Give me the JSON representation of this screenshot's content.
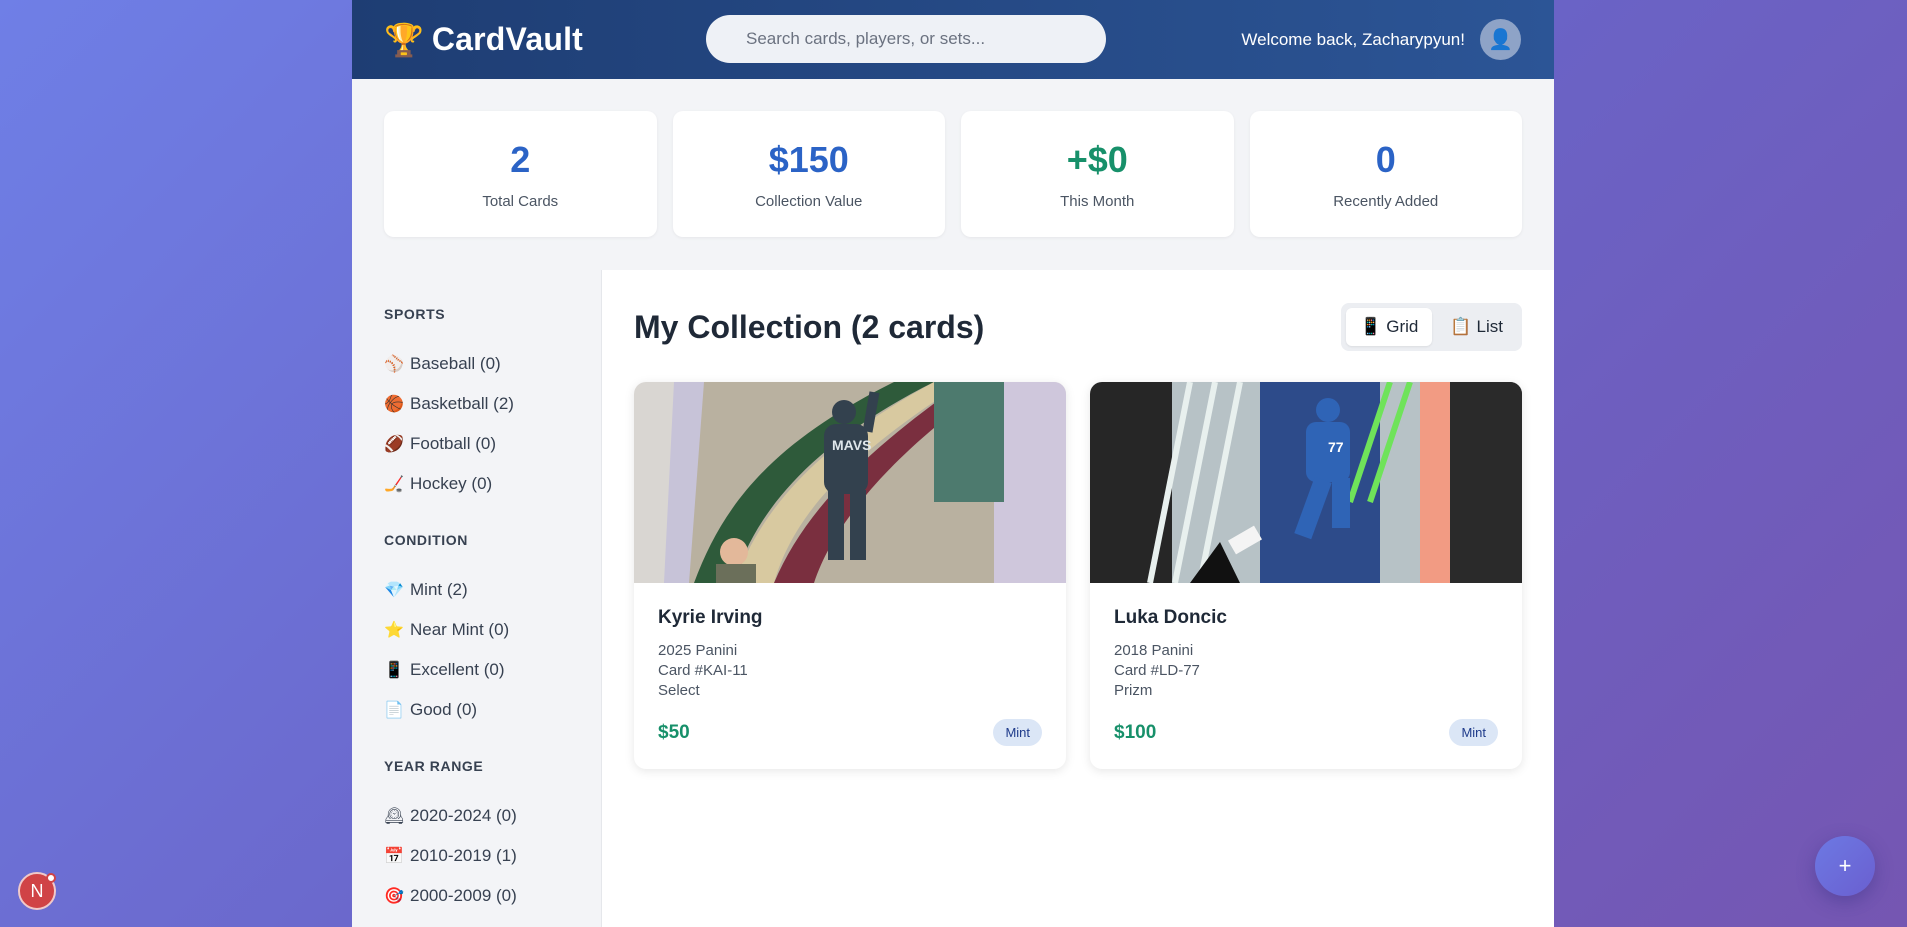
{
  "header": {
    "logo_icon": "trophy-icon",
    "logo_glyph": "🏆",
    "brand": "CardVault",
    "search_placeholder": "Search cards, players, or sets...",
    "welcome": "Welcome back, Zacharypyun!",
    "avatar_glyph": "👤"
  },
  "stats": [
    {
      "value": "2",
      "label": "Total Cards"
    },
    {
      "value": "$150",
      "label": "Collection Value"
    },
    {
      "value": "+$0",
      "label": "This Month"
    },
    {
      "value": "0",
      "label": "Recently Added"
    }
  ],
  "sidebar": {
    "sports": {
      "title": "SPORTS",
      "items": [
        {
          "icon": "⚾",
          "label": "Baseball (0)"
        },
        {
          "icon": "🏀",
          "label": "Basketball (2)"
        },
        {
          "icon": "🏈",
          "label": "Football (0)"
        },
        {
          "icon": "🏒",
          "label": "Hockey (0)"
        }
      ]
    },
    "condition": {
      "title": "CONDITION",
      "items": [
        {
          "icon": "💎",
          "label": "Mint (2)"
        },
        {
          "icon": "⭐",
          "label": "Near Mint (0)"
        },
        {
          "icon": "📱",
          "label": "Excellent (0)"
        },
        {
          "icon": "📄",
          "label": "Good (0)"
        }
      ]
    },
    "years": {
      "title": "YEAR RANGE",
      "items": [
        {
          "icon": "🕰",
          "label": "2020-2024 (0)"
        },
        {
          "icon": "📅",
          "label": "2010-2019 (1)"
        },
        {
          "icon": "🎯",
          "label": "2000-2009 (0)"
        }
      ]
    }
  },
  "main": {
    "title": "My Collection (2 cards)",
    "view_toggle": {
      "grid": {
        "icon": "📱",
        "label": "Grid"
      },
      "list": {
        "icon": "📋",
        "label": "List"
      }
    },
    "cards": [
      {
        "name": "Kyrie Irving",
        "year_brand": "2025 Panini",
        "number": "Card #KAI-11",
        "set": "Select",
        "price": "$50",
        "condition": "Mint"
      },
      {
        "name": "Luka Doncic",
        "year_brand": "2018 Panini",
        "number": "Card #LD-77",
        "set": "Prizm",
        "price": "$100",
        "condition": "Mint"
      }
    ]
  },
  "fab": {
    "glyph": "+"
  },
  "notif": {
    "glyph": "N"
  }
}
